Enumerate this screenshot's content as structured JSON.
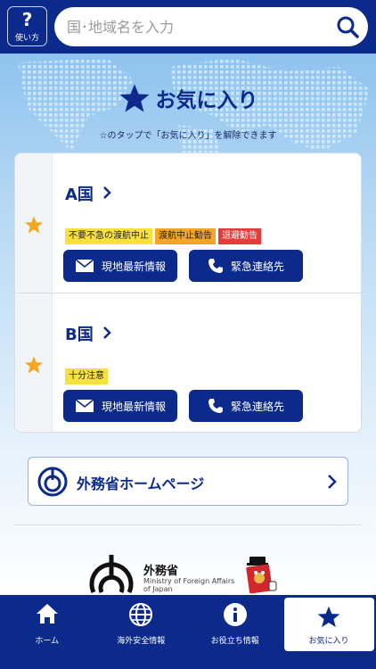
{
  "header": {
    "help_symbol": "?",
    "help_label": "使い方",
    "search_placeholder": "国･地域名を入力"
  },
  "favorites": {
    "title": "お気に入り",
    "subtitle": "☆のタップで「お気に入り」を解除できます"
  },
  "countries": [
    {
      "name": "A国",
      "badges": [
        {
          "label": "不要不急の渡航中止",
          "color": "yellow"
        },
        {
          "label": "渡航中止勧告",
          "color": "orange"
        },
        {
          "label": "退避勧告",
          "color": "red"
        }
      ],
      "local_info_label": "現地最新情報",
      "emergency_label": "緊急連絡先"
    },
    {
      "name": "B国",
      "badges": [
        {
          "label": "十分注意",
          "color": "yellow"
        }
      ],
      "local_info_label": "現地最新情報",
      "emergency_label": "緊急連絡先"
    }
  ],
  "home_link": {
    "label": "外務省ホームページ"
  },
  "footer": {
    "org_name": "外務省",
    "org_name_en_line1": "Ministry of Foreign Affairs",
    "org_name_en_line2": "of Japan"
  },
  "tabs": [
    {
      "label": "ホーム",
      "icon": "home-icon"
    },
    {
      "label": "海外安全情報",
      "icon": "globe-icon"
    },
    {
      "label": "お役立ち情報",
      "icon": "info-icon"
    },
    {
      "label": "お気に入り",
      "icon": "star-icon",
      "active": true
    }
  ],
  "colors": {
    "primary": "#0b2a8c",
    "star": "#f5a623",
    "badge_yellow": "#f9e13c",
    "badge_orange": "#f2a528",
    "badge_red": "#e63b3b"
  }
}
